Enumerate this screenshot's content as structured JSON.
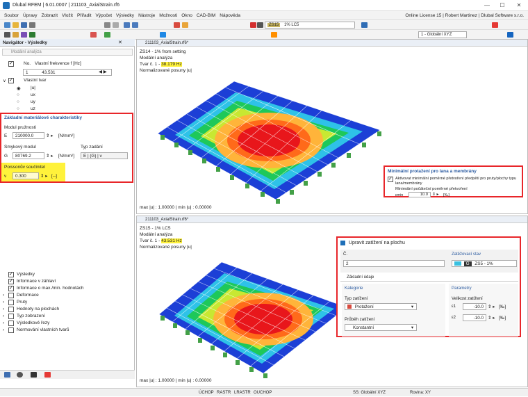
{
  "window": {
    "title": "Dlubal RFEM | 6.01.0007 | 211103_AxialStrain.rf6"
  },
  "menu": [
    "Soubor",
    "Úpravy",
    "Zobrazit",
    "Vložit",
    "Přiřadit",
    "Výpočet",
    "Výsledky",
    "Nástroje",
    "Možnosti",
    "Okno",
    "CAD-BIM",
    "Nápověda"
  ],
  "license": "Online License 15 | Robert Martinez | Dlubal Software s.r.o.",
  "toolbar": {
    "load_case_code": "ZS15",
    "load_case_name": "1% LC5",
    "coord_system": "1 - Globální XYZ"
  },
  "navigator": {
    "title": "Navigátor - Výsledky",
    "analysis_select": "Modální analýza",
    "freq_header_no": "No.",
    "freq_header_label": "Vlastní frekvence f [Hz]",
    "freq_no": "1",
    "freq_value": "43.531",
    "mode_shape": "Vlastní tvar",
    "components": [
      "|u|",
      "ux",
      "uy",
      "uz"
    ],
    "mat_title": "Základní materiálové charakteristiky",
    "elastic_label": "Modul pružnosti",
    "elastic_sym": "E",
    "elastic_value": "210000.0",
    "elastic_unit": "[N/mm²]",
    "shear_label": "Smykový modul",
    "shear_sym": "G",
    "shear_value": "80769.2",
    "shear_unit": "[N/mm²]",
    "input_type_label": "Typ zadání",
    "input_type_value": "E | (G) | ν",
    "poisson_label": "Poissonův součinitel",
    "poisson_sym": "ν",
    "poisson_value": "0.300",
    "poisson_unit": "[--]",
    "tree": [
      "Výsledky",
      "Informace v záhlaví",
      "Informace o max./min. hodnotách",
      "Deformace",
      "Pruty",
      "Hodnoty na plochách",
      "Typ zobrazení",
      "Výsledkové řezy",
      "Normování vlastních tvarů"
    ]
  },
  "view_top": {
    "tab": "211103_AxialStrain.rf6*",
    "line1": "ZS14 - 1% from setting",
    "line2": "Modální analýza",
    "line3_prefix": "Tvar č. 1 - ",
    "line3_value": "38.179 Hz",
    "line4": "Normalizované posuny |u|",
    "footer": "max |u| : 1.00000 | min |u| : 0.00000"
  },
  "view_bottom": {
    "tab": "211103_AxialStrain.rf6*",
    "line1": "ZS15 - 1% LC5",
    "line2": "Modální analýza",
    "line3_prefix": "Tvar č. 1 - ",
    "line3_value": "43.531 Hz",
    "line4": "Normalizované posuny |u|",
    "footer": "max |u| : 1.00000 | min |u| : 0.00000"
  },
  "min_strain": {
    "title": "Minimální protažení pro lana a membrány",
    "check_label": "Aktivovat minimální poměrné přetvoření předpětí pro pruty/plochy typu lana/membrány",
    "sub_label": "Minimální počáteční poměrné přetvoření",
    "sym": "εmin",
    "value": "10.0",
    "unit": "[‰]"
  },
  "load_dialog": {
    "title": "Upravit zatížení na plochu",
    "no_label": "Č.",
    "no_value": "2",
    "lc_label": "Zatěžovací stav",
    "lc_code": "G",
    "lc_value": "ZS5 - 1%",
    "tab": "Základní údaje",
    "cat_title": "Kategorie",
    "load_type_label": "Typ zatížení",
    "load_type_value": "Protažení",
    "dist_label": "Průběh zatížení",
    "dist_value": "Konstantní",
    "param_title": "Parametry",
    "size_label": "Velikost zatížení",
    "e1_sym": "ε1",
    "e1_value": "-10.0",
    "e1_unit": "[‰]",
    "e2_sym": "ε2",
    "e2_value": "-10.0",
    "e2_unit": "[‰]"
  },
  "status": [
    "ÚCHOP",
    "RASTR",
    "LRASTR",
    "OUCHOP",
    "SS: Globální XYZ",
    "Rovina: XY"
  ],
  "colors": {
    "highlight": "#fff23b",
    "red_frame": "#e8262a"
  }
}
